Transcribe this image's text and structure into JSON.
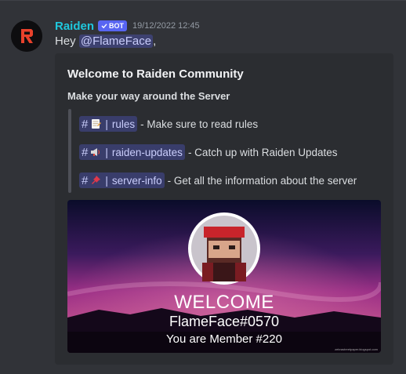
{
  "message": {
    "author": "Raiden",
    "bot_tag": "BOT",
    "timestamp": "19/12/2022 12:45",
    "greeting": "Hey",
    "mention": "@FlameFace",
    "trailing": ","
  },
  "embed": {
    "title": "Welcome to Raiden Community",
    "subtitle": "Make your way around the Server",
    "channels": [
      {
        "icon": "memo-emoji",
        "name": "rules",
        "description": "- Make sure to read rules"
      },
      {
        "icon": "loudspeaker-emoji",
        "name": "raiden-updates",
        "description": "- Catch up with Raiden Updates"
      },
      {
        "icon": "pushpin-emoji",
        "name": "server-info",
        "description": "- Get all the information about the server"
      }
    ],
    "image": {
      "heading": "WELCOME",
      "username": "FlameFace#0570",
      "member_line": "You are Member #220",
      "watermark": "zebrastreetpaper.blogspot.com"
    }
  },
  "colors": {
    "background": "#313338",
    "embed": "#2b2d31",
    "username": "#1fc7dc",
    "bot_tag": "#5865f2",
    "mention_bg": "#414675",
    "mention_text": "#c9cdfb"
  }
}
